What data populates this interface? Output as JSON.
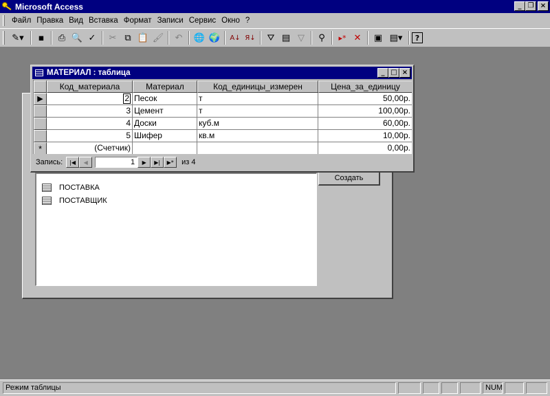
{
  "app": {
    "title": "Microsoft Access",
    "window_buttons": {
      "minimize": "_",
      "restore": "❐",
      "close": "×"
    }
  },
  "menu": {
    "items": [
      "Файл",
      "Правка",
      "Вид",
      "Вставка",
      "Формат",
      "Записи",
      "Сервис",
      "Окно",
      "?"
    ]
  },
  "toolbar": {
    "buttons": [
      {
        "name": "view-design-icon",
        "glyph": "✎▾"
      },
      {
        "name": "save-icon",
        "glyph": "▪"
      },
      {
        "name": "print-icon",
        "glyph": "⎙"
      },
      {
        "name": "print-preview-icon",
        "glyph": "🔍"
      },
      {
        "name": "spelling-icon",
        "glyph": "✓"
      },
      {
        "name": "cut-icon",
        "glyph": "✂"
      },
      {
        "name": "copy-icon",
        "glyph": "⧉"
      },
      {
        "name": "paste-icon",
        "glyph": "📋"
      },
      {
        "name": "format-painter-icon",
        "glyph": "🖌"
      },
      {
        "name": "undo-icon",
        "glyph": "↶"
      },
      {
        "name": "insert-hyperlink-icon",
        "glyph": "🌐"
      },
      {
        "name": "web-toolbar-icon",
        "glyph": "🌍"
      },
      {
        "name": "sort-ascending-icon",
        "glyph": "A↓"
      },
      {
        "name": "sort-descending-icon",
        "glyph": "Я↓"
      },
      {
        "name": "filter-by-selection-icon",
        "glyph": "⛛"
      },
      {
        "name": "filter-by-form-icon",
        "glyph": "▤"
      },
      {
        "name": "apply-filter-icon",
        "glyph": "▽"
      },
      {
        "name": "find-icon",
        "glyph": "⚲"
      },
      {
        "name": "new-record-icon",
        "glyph": "▸*"
      },
      {
        "name": "delete-record-icon",
        "glyph": "✕"
      },
      {
        "name": "database-window-icon",
        "glyph": "▣"
      },
      {
        "name": "new-object-icon",
        "glyph": "▤▾"
      },
      {
        "name": "help-icon",
        "glyph": "?"
      }
    ]
  },
  "db_window": {
    "items": [
      "ПОСТАВКА",
      "ПОСТАВЩИК"
    ],
    "create_button": "Создать"
  },
  "table_window": {
    "title": "МАТЕРИАЛ : таблица",
    "columns": [
      "Код_материала",
      "Материал",
      "Код_единицы_измерен",
      "Цена_за_единицу"
    ],
    "rows": [
      {
        "id": "2",
        "material": "Песок",
        "unit": "т",
        "price": "50,00р."
      },
      {
        "id": "3",
        "material": "Цемент",
        "unit": "т",
        "price": "100,00р."
      },
      {
        "id": "4",
        "material": "Доски",
        "unit": "куб.м",
        "price": "60,00р."
      },
      {
        "id": "5",
        "material": "Шифер",
        "unit": "кв.м",
        "price": "10,00р."
      }
    ],
    "new_row": {
      "id": "(Счетчик)",
      "price": "0,00р."
    },
    "new_row_marker": "*",
    "current_row_marker": "▶",
    "navigation": {
      "label": "Запись:",
      "current": "1",
      "of_label": "из 4"
    }
  },
  "statusbar": {
    "mode": "Режим таблицы",
    "num": "NUM"
  }
}
